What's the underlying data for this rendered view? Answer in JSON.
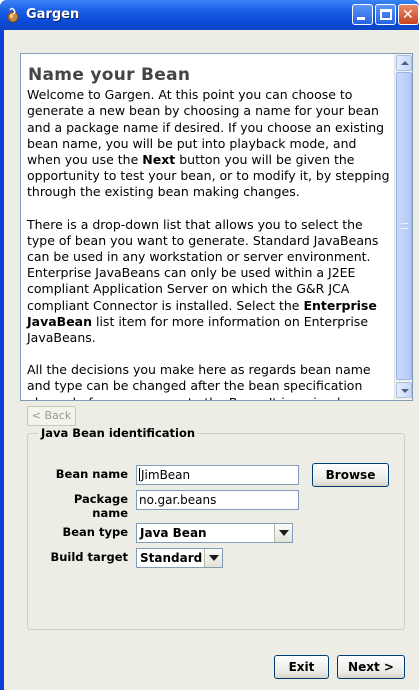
{
  "window": {
    "title": "Gargen"
  },
  "help": {
    "heading": "Name your Bean",
    "paragraph1": {
      "before": "Welcome to Gargen. At this point you can choose to generate a new bean by choosing a name for your bean and a package name if desired. If you choose an existing bean name, you will be put into playback mode, and when you use the ",
      "strong": "Next",
      "after": " button you will be given the opportunity to test your bean, or to modify it, by stepping through the existing bean making changes."
    },
    "paragraph2": {
      "before": "There is a drop-down list that allows you to select the type of bean you want to generate. Standard JavaBeans can be used in any workstation or server environment. Enterprise JavaBeans can only be used within a J2EE compliant Application Server on which the G&R JCA compliant Connector is installed. Select the ",
      "strong": "Enterprise JavaBean",
      "after": " list item for more information on Enterprise JavaBeans."
    },
    "paragraph3": "All the decisions you make here as regards bean name and type can be changed after the bean specification phase, before you generate the Bean. It is a simple matter to modify a Standard JavaBean, and generate it once more as an Enterprise JavaBean."
  },
  "nav": {
    "back_label": "< Back",
    "back_enabled": false
  },
  "identification": {
    "group_title": "Java Bean identification",
    "bean_name_label": "Bean name",
    "bean_name_value": "JimBean",
    "browse_label": "Browse",
    "package_name_label": "Package name",
    "package_name_value": "no.gar.beans",
    "bean_type_label": "Bean type",
    "bean_type_value": "Java Bean",
    "build_target_label": "Build target",
    "build_target_value": "Standard"
  },
  "footer": {
    "exit_label": "Exit",
    "next_label": "Next >"
  },
  "colors": {
    "titlebar": "#0b4bd8",
    "window_bg": "#eeede5",
    "field_border": "#7f9db9",
    "button_border": "#003c74"
  },
  "icons": [
    "bean-app-icon",
    "minimize-icon",
    "maximize-icon",
    "close-icon",
    "scroll-up-icon",
    "scroll-down-icon",
    "dropdown-arrow-icon"
  ]
}
